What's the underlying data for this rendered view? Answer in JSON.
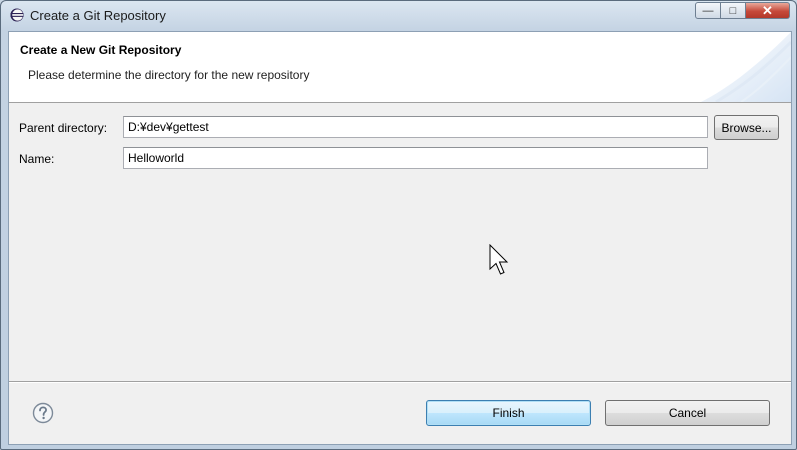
{
  "window": {
    "title": "Create a Git Repository",
    "buttons": {
      "minimize": "—",
      "maximize": "□",
      "close": "✕"
    }
  },
  "header": {
    "title": "Create a New Git Repository",
    "description": "Please determine the directory for the new repository"
  },
  "form": {
    "parent_directory": {
      "label": "Parent directory:",
      "value": "D:¥dev¥gettest"
    },
    "name": {
      "label": "Name:",
      "value": "Helloworld"
    },
    "browse_label": "Browse..."
  },
  "footer": {
    "finish_label": "Finish",
    "cancel_label": "Cancel",
    "help_icon": "question-mark-circle"
  },
  "colors": {
    "default_button_border": "#3c7fb1",
    "header_background": "#ffffff",
    "dialog_background": "#f0f0f0"
  }
}
